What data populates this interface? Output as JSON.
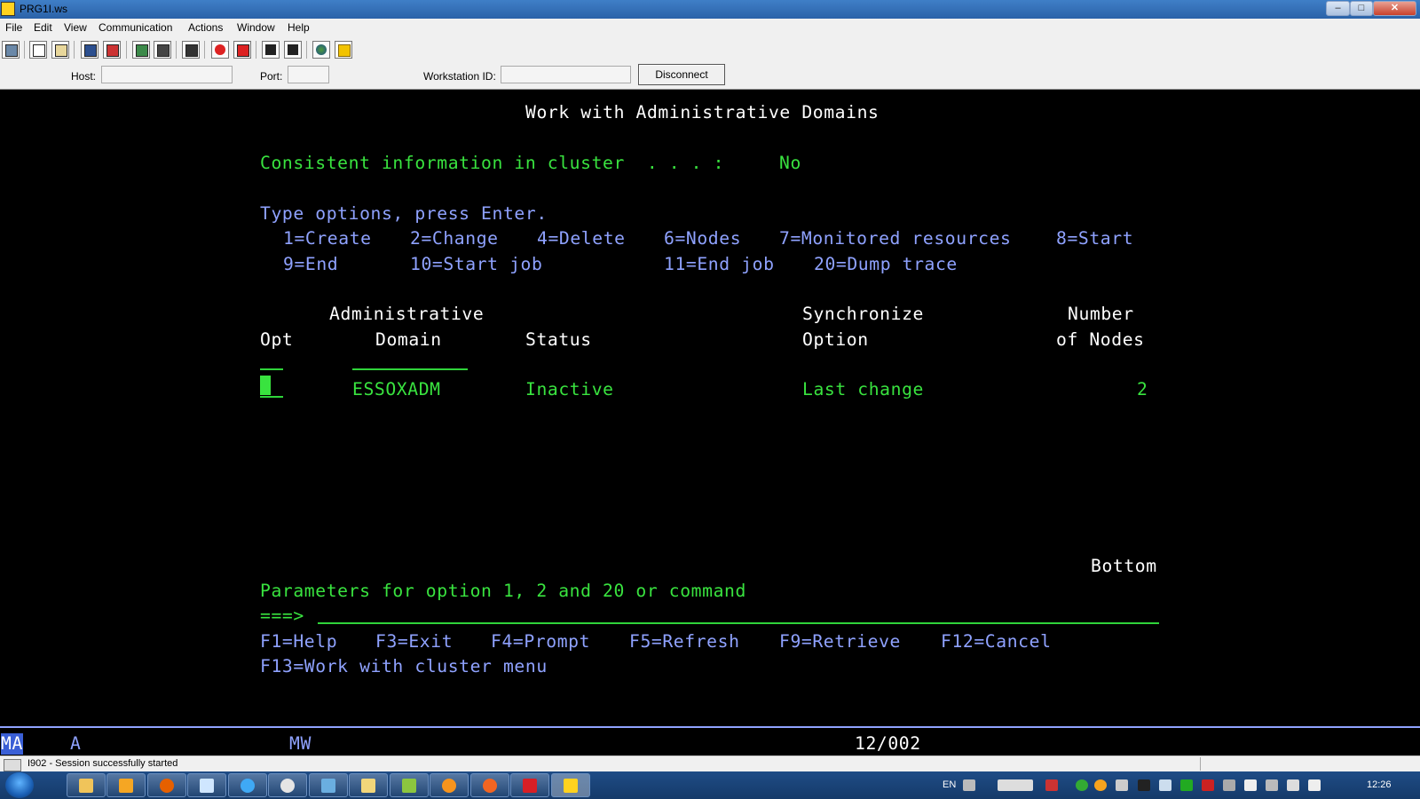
{
  "window": {
    "title": "PRG1I.ws",
    "minimize": "–",
    "maximize": "□",
    "close": "✕"
  },
  "menu": [
    "File",
    "Edit",
    "View",
    "Communication",
    "Actions",
    "Window",
    "Help"
  ],
  "connection": {
    "host_label": "Host:",
    "host_value": "",
    "port_label": "Port:",
    "port_value": "",
    "workstation_label": "Workstation ID:",
    "workstation_value": "",
    "disconnect_label": "Disconnect"
  },
  "terminal": {
    "title": "Work with Administrative Domains",
    "consistent_label": "Consistent information in cluster  . . . :",
    "consistent_value": "No",
    "instructions": "Type options, press Enter.",
    "options_row1": [
      "1=Create",
      "2=Change",
      "4=Delete",
      "6=Nodes",
      "7=Monitored resources",
      "8=Start"
    ],
    "options_row2": [
      "9=End",
      "10=Start job",
      "11=End job",
      "20=Dump trace"
    ],
    "headers": {
      "admin": "Administrative",
      "opt": "Opt",
      "domain": "Domain",
      "status": "Status",
      "synchronize": "Synchronize",
      "option": "Option",
      "number": "Number",
      "of_nodes": "of Nodes"
    },
    "rows": [
      {
        "opt": "",
        "domain": "ESSOXADM",
        "status": "Inactive",
        "sync_option": "Last change",
        "nodes": "2"
      }
    ],
    "bottom": "Bottom",
    "parameters_label": "Parameters for option 1, 2 and 20 or command",
    "prompt": "===>",
    "command_value": "",
    "fkeys_row1": [
      "F1=Help",
      "F3=Exit",
      "F4=Prompt",
      "F5=Refresh",
      "F9=Retrieve",
      "F12=Cancel"
    ],
    "fkeys_row2": [
      "F13=Work with cluster menu"
    ]
  },
  "oia": {
    "indicator": "MA",
    "mode": "A",
    "mw": "MW",
    "cursor_pos": "12/002"
  },
  "statusbar": {
    "message": "I902 - Session successfully started"
  },
  "tray": {
    "language": "EN",
    "clock": "12:26"
  },
  "colors": {
    "terminal_white": "#ffffff",
    "terminal_green": "#39e33f",
    "terminal_blue": "#8fa2ff",
    "taskbar": "#1f4c86"
  },
  "toolbar_icons": [
    "print-screen-icon",
    "copy-icon",
    "paste-icon",
    "send-icon",
    "receive-icon",
    "display-icon",
    "keypad-icon",
    "macro-icon",
    "record-macro-icon",
    "stop-macro-icon",
    "play-macro-icon",
    "run-macro-icon",
    "globe-icon",
    "help-icon"
  ],
  "taskbar_apps": [
    "file-explorer-icon",
    "media-player-icon",
    "firefox-icon",
    "notepad-icon",
    "internet-explorer-icon",
    "clock-app-icon",
    "network-icon",
    "folders-icon",
    "green-app-icon",
    "orange-app-icon",
    "sametime-icon",
    "acrobat-icon",
    "pcomm-icon"
  ]
}
